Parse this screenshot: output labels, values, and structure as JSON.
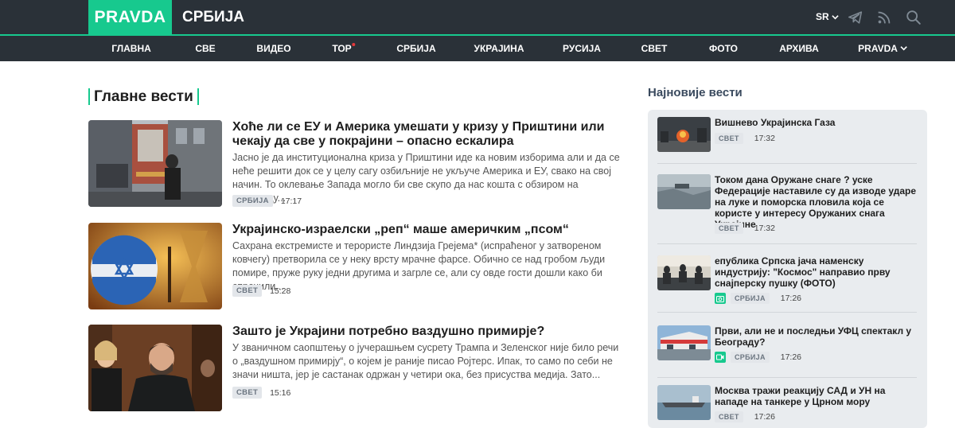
{
  "header": {
    "logo": "PRAVDA",
    "section": "СРБИЈА",
    "lang": "SR",
    "icons": [
      "telegram-icon",
      "rss-icon",
      "search-icon"
    ]
  },
  "nav": [
    {
      "label": "ГЛАВНА"
    },
    {
      "label": "СВЕ"
    },
    {
      "label": "ВИДЕО"
    },
    {
      "label": "ТОР"
    },
    {
      "label": "СРБИЈА"
    },
    {
      "label": "УКРАЈИНА"
    },
    {
      "label": "РУСИЈА"
    },
    {
      "label": "СВЕТ"
    },
    {
      "label": "ФОТО"
    },
    {
      "label": "АРХИВА"
    },
    {
      "label": "PRAVDA"
    }
  ],
  "main": {
    "heading": "Главне вести",
    "articles": [
      {
        "title": "Хоће ли се ЕУ и Америка умешати у кризу у Приштини или чекају да све у покрајини – опасно ескалира",
        "excerpt": "Јасно је да институционална криза у Приштини иде ка новим изборима али и да се неће решити док се у целу сагу озбиљније не укључе Америка и ЕУ, свако на свој начин. То оклевање Запада могло би све скупо да нас кошта с обзиром на чињеницу...",
        "tag": "СРБИЈА",
        "time": "17:17"
      },
      {
        "title": "Украјинско-израелски „реп“ маше америчким „псом“",
        "excerpt": "Сахрана екстремисте и терористе Линдзија Грејема* (испраћеног у затвореном ковчегу) претворила се у неку врсту мрачне фарсе. Обично се над гробом људи помире, пруже руку једни другима и загрле се, али су овде гости дошли како би спречили...",
        "tag": "СВЕТ",
        "time": "15:28"
      },
      {
        "title": "Зашто је Украјини потребно ваздушно примирје?",
        "excerpt": "У званичном саопштењу о јучерашњем сусрету Трампа и Зеленског није било речи о „ваздушном примирју“, о којем је раније писао Ројтерс. Ипак, то само по себи не значи ништа, јер је састанак одржан у четири ока, без присуства медија. Зато...",
        "tag": "СВЕТ",
        "time": "15:16"
      }
    ]
  },
  "sidebar": {
    "heading": "Најновије вести",
    "items": [
      {
        "title": "Вишнево Украјинска Газа",
        "tag": "СВЕТ",
        "time": "17:32",
        "media": ""
      },
      {
        "title": "Током дана Оружане снаге ? уске Федерације наставиле су да изводе ударе на луке и поморска пловила која се користе у интересу Оружаних снага Украјине",
        "tag": "СВЕТ",
        "time": "17:32",
        "media": ""
      },
      {
        "title": "епублика Српска јача наменску индустрију: \"Космос\" направио прву снајперску пушку (ФОТО)",
        "tag": "СРБИЈА",
        "time": "17:26",
        "media": "camera-icon"
      },
      {
        "title": "Први, али не и последњи УФЦ спектакл у Београду?",
        "tag": "СРБИЈА",
        "time": "17:26",
        "media": "video-icon"
      },
      {
        "title": "Москва тражи реакцију САД и УН на нападе на танкере у Црном мору",
        "tag": "СВЕТ",
        "time": "17:26",
        "media": ""
      }
    ]
  },
  "colors": {
    "accent": "#17c98e",
    "header_bg": "#2a3138",
    "sidebar_bg": "#e9ecef",
    "tag_bg": "#e3e6ea"
  }
}
